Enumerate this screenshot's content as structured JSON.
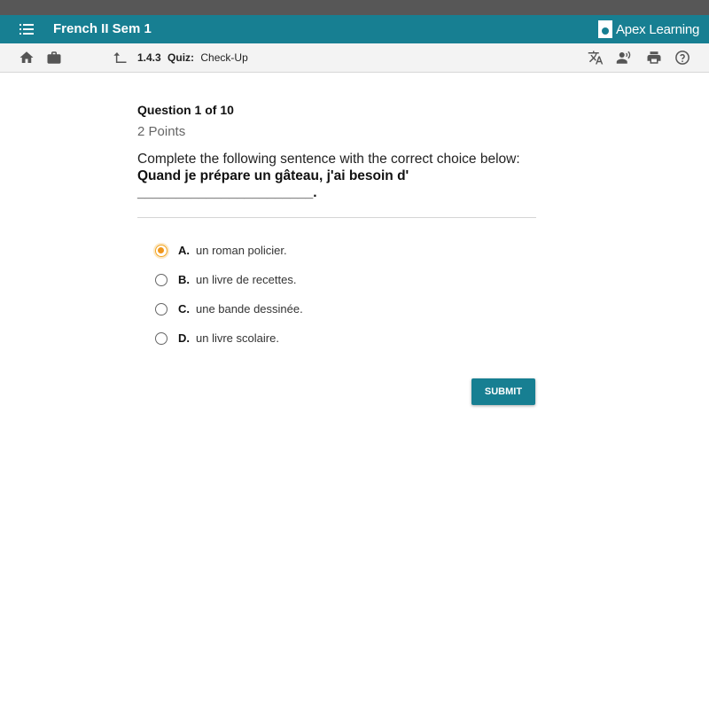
{
  "header": {
    "course_title": "French II Sem 1",
    "logo_text": "Apex Learning"
  },
  "toolbar": {
    "section_number": "1.4.3",
    "activity_type": "Quiz:",
    "activity_name": "Check-Up",
    "icons": [
      "home-icon",
      "briefcase-icon",
      "up-arrow-icon",
      "translate-icon",
      "read-aloud-icon",
      "print-icon",
      "help-icon"
    ]
  },
  "question": {
    "number_label": "Question 1 of 10",
    "points": "2 Points",
    "prompt": "Complete the following sentence with the correct choice below:",
    "sentence": "Quand je prépare un gâteau, j'ai besoin d'",
    "blank": "_______________________."
  },
  "choices": [
    {
      "letter": "A.",
      "text": "un roman policier.",
      "selected": true
    },
    {
      "letter": "B.",
      "text": "un livre de recettes.",
      "selected": false
    },
    {
      "letter": "C.",
      "text": "une bande dessinée.",
      "selected": false
    },
    {
      "letter": "D.",
      "text": "un livre scolaire.",
      "selected": false
    }
  ],
  "submit_label": "SUBMIT",
  "colors": {
    "brand": "#177f92",
    "selected": "#f0961c"
  }
}
